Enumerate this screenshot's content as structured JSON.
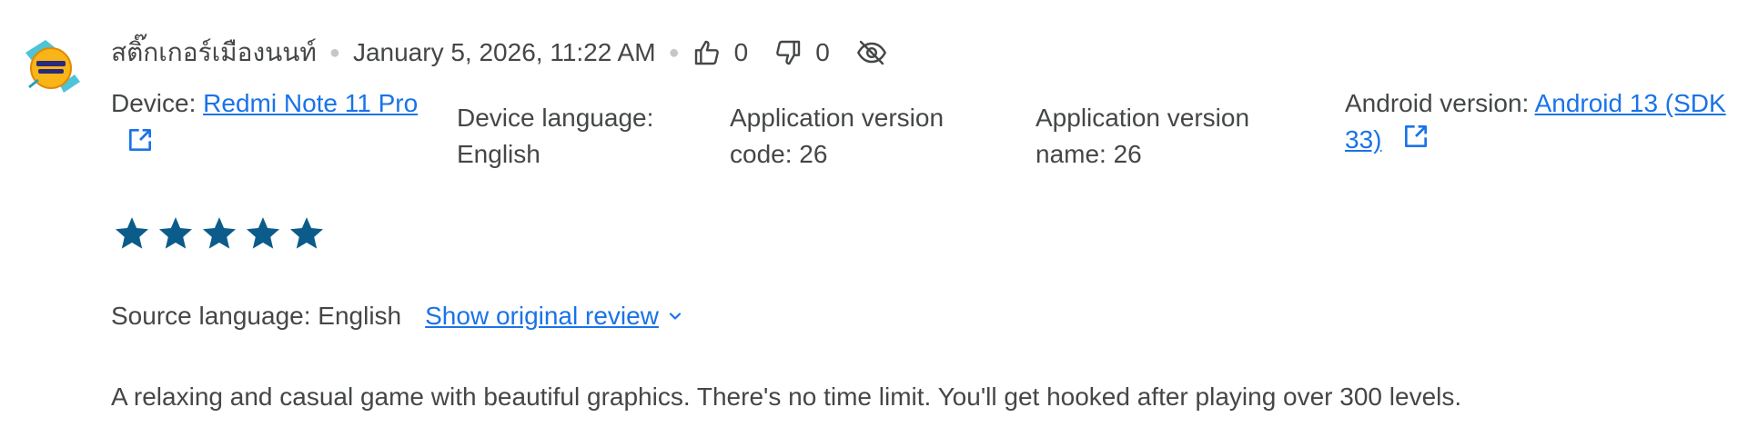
{
  "review": {
    "author": "สติ๊กเกอร์เมืองนนท์",
    "timestamp": "January 5, 2026, 11:22 AM",
    "likes": "0",
    "dislikes": "0",
    "rating": 5,
    "rating_max": 5,
    "device_label": "Device: ",
    "device_value": "Redmi Note 11 Pro",
    "device_language": "Device language: English",
    "app_version_code": "Application version code: 26",
    "app_version_name": "Application version name: 26",
    "android_label": "Android version: ",
    "android_value_1": "Android 13 (SDK",
    "android_value_2": "33)",
    "source_language": "Source language: English",
    "show_original": "Show original review",
    "text": "A relaxing and casual game with beautiful graphics. There's no time limit. You'll get hooked after playing over 300 levels."
  },
  "icons": {
    "thumb_up": "thumb-up-icon",
    "thumb_down": "thumb-down-icon",
    "hide": "visibility-off-icon",
    "external": "open-in-new-icon",
    "star": "star-icon",
    "chevron": "chevron-down-icon"
  },
  "colors": {
    "star": "#0b5c8a",
    "link": "#1a73e8",
    "text": "#444746"
  }
}
